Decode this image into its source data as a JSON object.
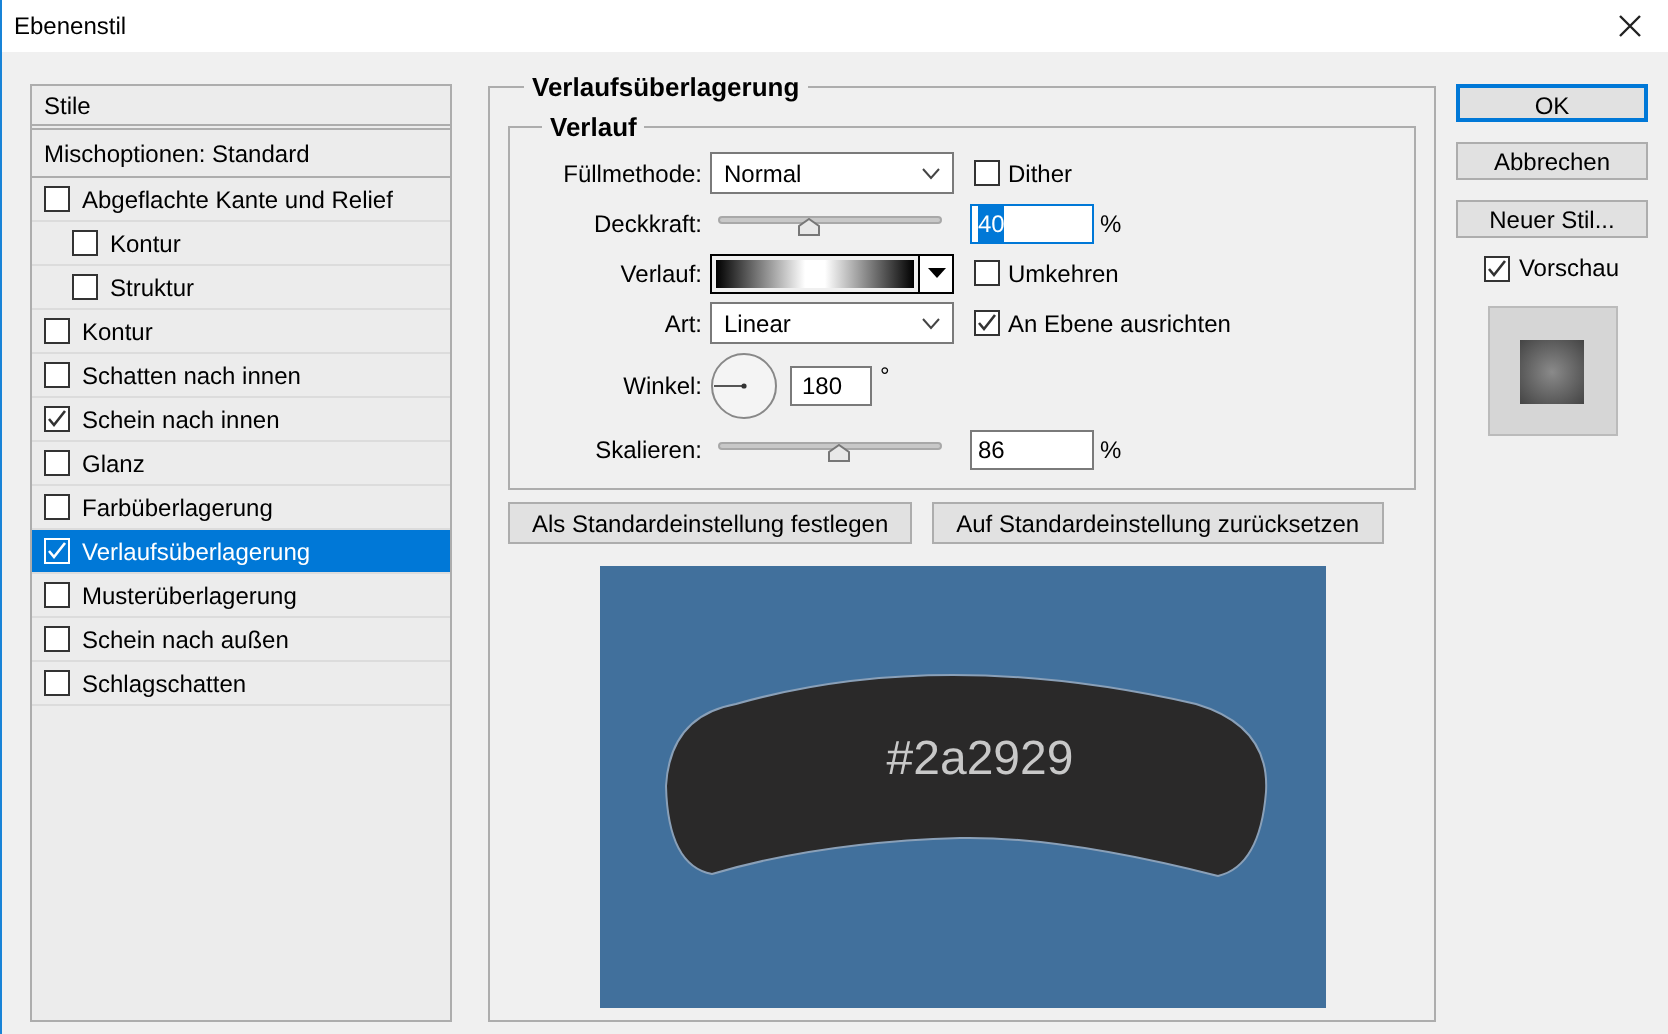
{
  "window": {
    "title": "Ebenenstil"
  },
  "styles": {
    "header": "Stile",
    "blend_options": "Mischoptionen: Standard",
    "items": [
      {
        "label": "Abgeflachte Kante und Relief",
        "checked": false,
        "selected": false,
        "children": [
          {
            "label": "Kontur",
            "checked": false,
            "selected": false
          },
          {
            "label": "Struktur",
            "checked": false,
            "selected": false
          }
        ]
      },
      {
        "label": "Kontur",
        "checked": false,
        "selected": false
      },
      {
        "label": "Schatten nach innen",
        "checked": false,
        "selected": false
      },
      {
        "label": "Schein nach innen",
        "checked": true,
        "selected": false
      },
      {
        "label": "Glanz",
        "checked": false,
        "selected": false
      },
      {
        "label": "Farbüberlagerung",
        "checked": false,
        "selected": false
      },
      {
        "label": "Verlaufsüberlagerung",
        "checked": true,
        "selected": true
      },
      {
        "label": "Musterüberlagerung",
        "checked": false,
        "selected": false
      },
      {
        "label": "Schein nach außen",
        "checked": false,
        "selected": false
      },
      {
        "label": "Schlagschatten",
        "checked": false,
        "selected": false
      }
    ]
  },
  "panel": {
    "title": "Verlaufsüberlagerung",
    "group": "Verlauf",
    "blend_mode": {
      "label": "Füllmethode:",
      "value": "Normal"
    },
    "dither": {
      "label": "Dither",
      "checked": false
    },
    "opacity": {
      "label": "Deckkraft:",
      "level": 0.4,
      "value": "40",
      "unit": "%"
    },
    "gradient": {
      "label": "Verlauf:"
    },
    "reverse": {
      "label": "Umkehren",
      "checked": false
    },
    "style": {
      "label": "Art:",
      "value": "Linear"
    },
    "align": {
      "label": "An Ebene ausrichten",
      "checked": true
    },
    "angle": {
      "label": "Winkel:",
      "value": "180",
      "unit": "°"
    },
    "scale": {
      "label": "Skalieren:",
      "level": 0.54,
      "value": "86",
      "unit": "%"
    },
    "buttons": [
      "Als Standardeinstellung festlegen",
      "Auf Standardeinstellung zurücksetzen"
    ]
  },
  "canvas": {
    "text": "#2a2929"
  },
  "actions": [
    {
      "label": "OK",
      "default": true
    },
    {
      "label": "Abbrechen",
      "default": false
    },
    {
      "label": "Neuer Stil...",
      "default": false
    }
  ],
  "preview": {
    "label": "Vorschau",
    "checked": true
  }
}
